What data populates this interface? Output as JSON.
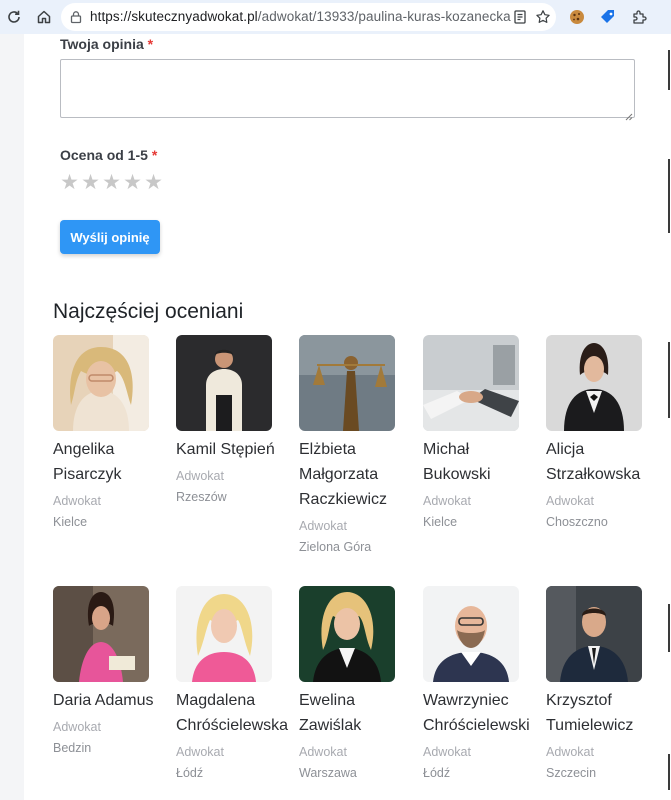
{
  "browser": {
    "url_host": "https://skutecznyadwokat.pl",
    "url_path": "/adwokat/13933/paulina-kuras-kozanecka"
  },
  "form": {
    "opinion_label": "Twoja opinia",
    "rating_label": "Ocena od 1-5",
    "required_mark": "*",
    "rating_value": 0,
    "rating_max": 5,
    "submit_label": "Wyślij opinię"
  },
  "section": {
    "title": "Najczęściej oceniani"
  },
  "lawyers": [
    {
      "name": "Angelika Pisarczyk",
      "role": "Adwokat",
      "city": "Kielce"
    },
    {
      "name": "Kamil Stępień",
      "role": "Adwokat",
      "city": "Rzeszów"
    },
    {
      "name": "Elżbieta Małgorzata Raczkiewicz",
      "role": "Adwokat",
      "city": "Zielona Góra"
    },
    {
      "name": "Michał Bukowski",
      "role": "Adwokat",
      "city": "Kielce"
    },
    {
      "name": "Alicja Strzałkowska",
      "role": "Adwokat",
      "city": "Choszczno"
    },
    {
      "name": "Daria Adamus",
      "role": "Adwokat",
      "city": "Bedzin"
    },
    {
      "name": "Magdalena Chróścielewska",
      "role": "Adwokat",
      "city": "Łódź"
    },
    {
      "name": "Ewelina Zawiślak",
      "role": "Adwokat",
      "city": "Warszawa"
    },
    {
      "name": "Wawrzyniec Chróścielewski",
      "role": "Adwokat",
      "city": "Łódź"
    },
    {
      "name": "Krzysztof Tumielewicz",
      "role": "Adwokat",
      "city": "Szczecin"
    }
  ],
  "colors": {
    "accent": "#2f96f5",
    "required": "#e53935",
    "star_empty": "#c8c8c8"
  }
}
